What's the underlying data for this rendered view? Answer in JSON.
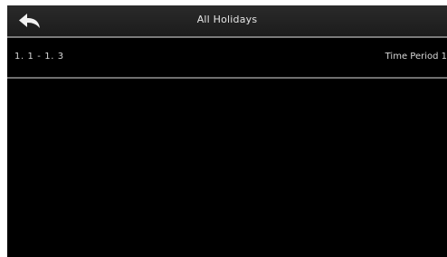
{
  "header": {
    "title": "All Holidays",
    "back_icon": "back-arrow-icon"
  },
  "holidays": [
    {
      "range": "1. 1 - 1. 3",
      "time_period": "Time Period 1"
    }
  ],
  "colors": {
    "background": "#000000",
    "header_background": "#232323",
    "divider": "#7a7a7a",
    "text": "#d8d8d8"
  }
}
